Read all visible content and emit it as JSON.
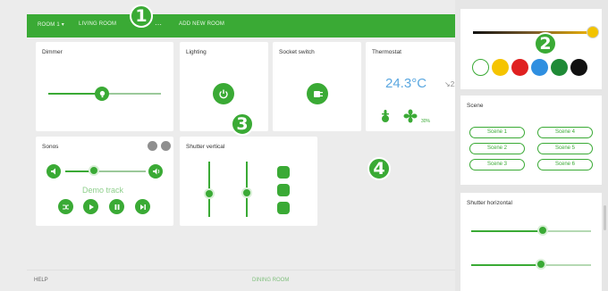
{
  "nav": {
    "items": [
      {
        "label": "ROOM 1 ▾"
      },
      {
        "label": "LIVING ROOM"
      },
      {
        "label": "ADD NEW ROOM"
      }
    ]
  },
  "cards": {
    "dimmer": {
      "title": "Dimmer",
      "level": 0.55
    },
    "lighting": {
      "title": "Lighting"
    },
    "socket": {
      "title": "Socket switch"
    },
    "thermostat": {
      "title": "Thermostat",
      "temperature": "24.3°C",
      "target": "↘21",
      "humidity": "30%"
    },
    "sonos": {
      "title": "Sonos",
      "track": "Demo track",
      "volume": 0.35
    },
    "shutter_vertical": {
      "title": "Shutter vertical",
      "levels": [
        0.35,
        0.6
      ]
    }
  },
  "right": {
    "colors": [
      "#ffffff",
      "#f5c400",
      "#e02020",
      "#2f8fe0",
      "#1f8a36",
      "#111111"
    ],
    "scene": {
      "title": "Scene",
      "buttons": [
        "Scene 1",
        "Scene 4",
        "Scene 2",
        "Scene 5",
        "Scene 3",
        "Scene 6"
      ]
    },
    "shutter_horizontal": {
      "title": "Shutter horizontal",
      "levels": [
        0.55,
        0.55
      ]
    }
  },
  "footer": {
    "help": "HELP",
    "center": "DINING ROOM"
  },
  "markers": [
    "1",
    "2",
    "3",
    "4"
  ]
}
